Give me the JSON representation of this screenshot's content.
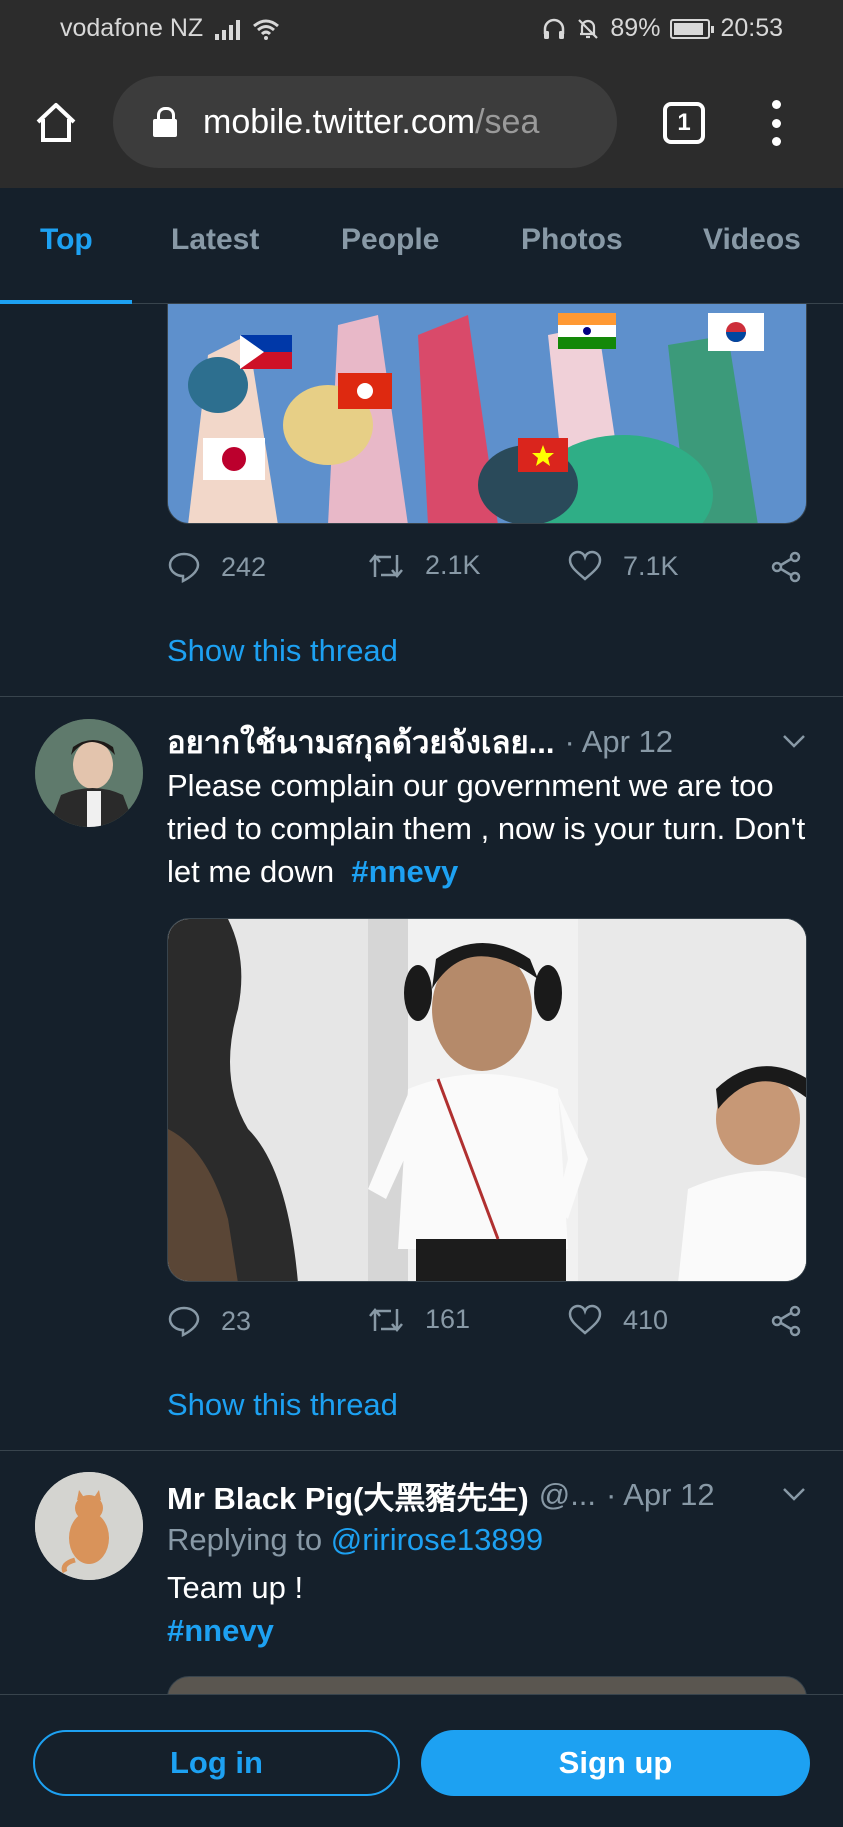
{
  "status_bar": {
    "carrier": "vodafone NZ",
    "battery_text": "89%",
    "battery_level": 0.89,
    "time": "20:53",
    "icons": [
      "signal-icon",
      "wifi-icon",
      "headphones-icon",
      "bell-off-icon",
      "battery-icon"
    ]
  },
  "browser": {
    "url_host": "mobile.twitter.com",
    "url_path": "/sea",
    "tab_count": "1"
  },
  "tabs": [
    {
      "label": "Top",
      "active": true
    },
    {
      "label": "Latest",
      "active": false
    },
    {
      "label": "People",
      "active": false
    },
    {
      "label": "Photos",
      "active": false
    },
    {
      "label": "Videos",
      "active": false
    }
  ],
  "tweets": [
    {
      "image_desc": "anime-illustration-with-flags",
      "replies": "242",
      "retweets": "2.1K",
      "likes": "7.1K",
      "show_thread": "Show this thread"
    },
    {
      "name": "อยากใช้นามสกุลด้วยจังเลย...",
      "date": "· Apr 12",
      "text": "Please complain our government we are too tried to complain them , now is your turn. Don't let me down",
      "hashtag": "#nnevy",
      "replies": "23",
      "retweets": "161",
      "likes": "410",
      "show_thread": "Show this thread"
    },
    {
      "name": "Mr Black Pig(大黑豬先生)",
      "handle": "@...",
      "date": "· Apr 12",
      "replying_prefix": "Replying to",
      "replying_to": "@ririrose13899",
      "text": "Team up !",
      "hashtag": "#nnevy"
    }
  ],
  "bottom": {
    "login": "Log in",
    "signup": "Sign up"
  },
  "colors": {
    "background": "#15202b",
    "accent": "#1da1f2",
    "muted": "#8899a6",
    "border": "#38444d"
  }
}
